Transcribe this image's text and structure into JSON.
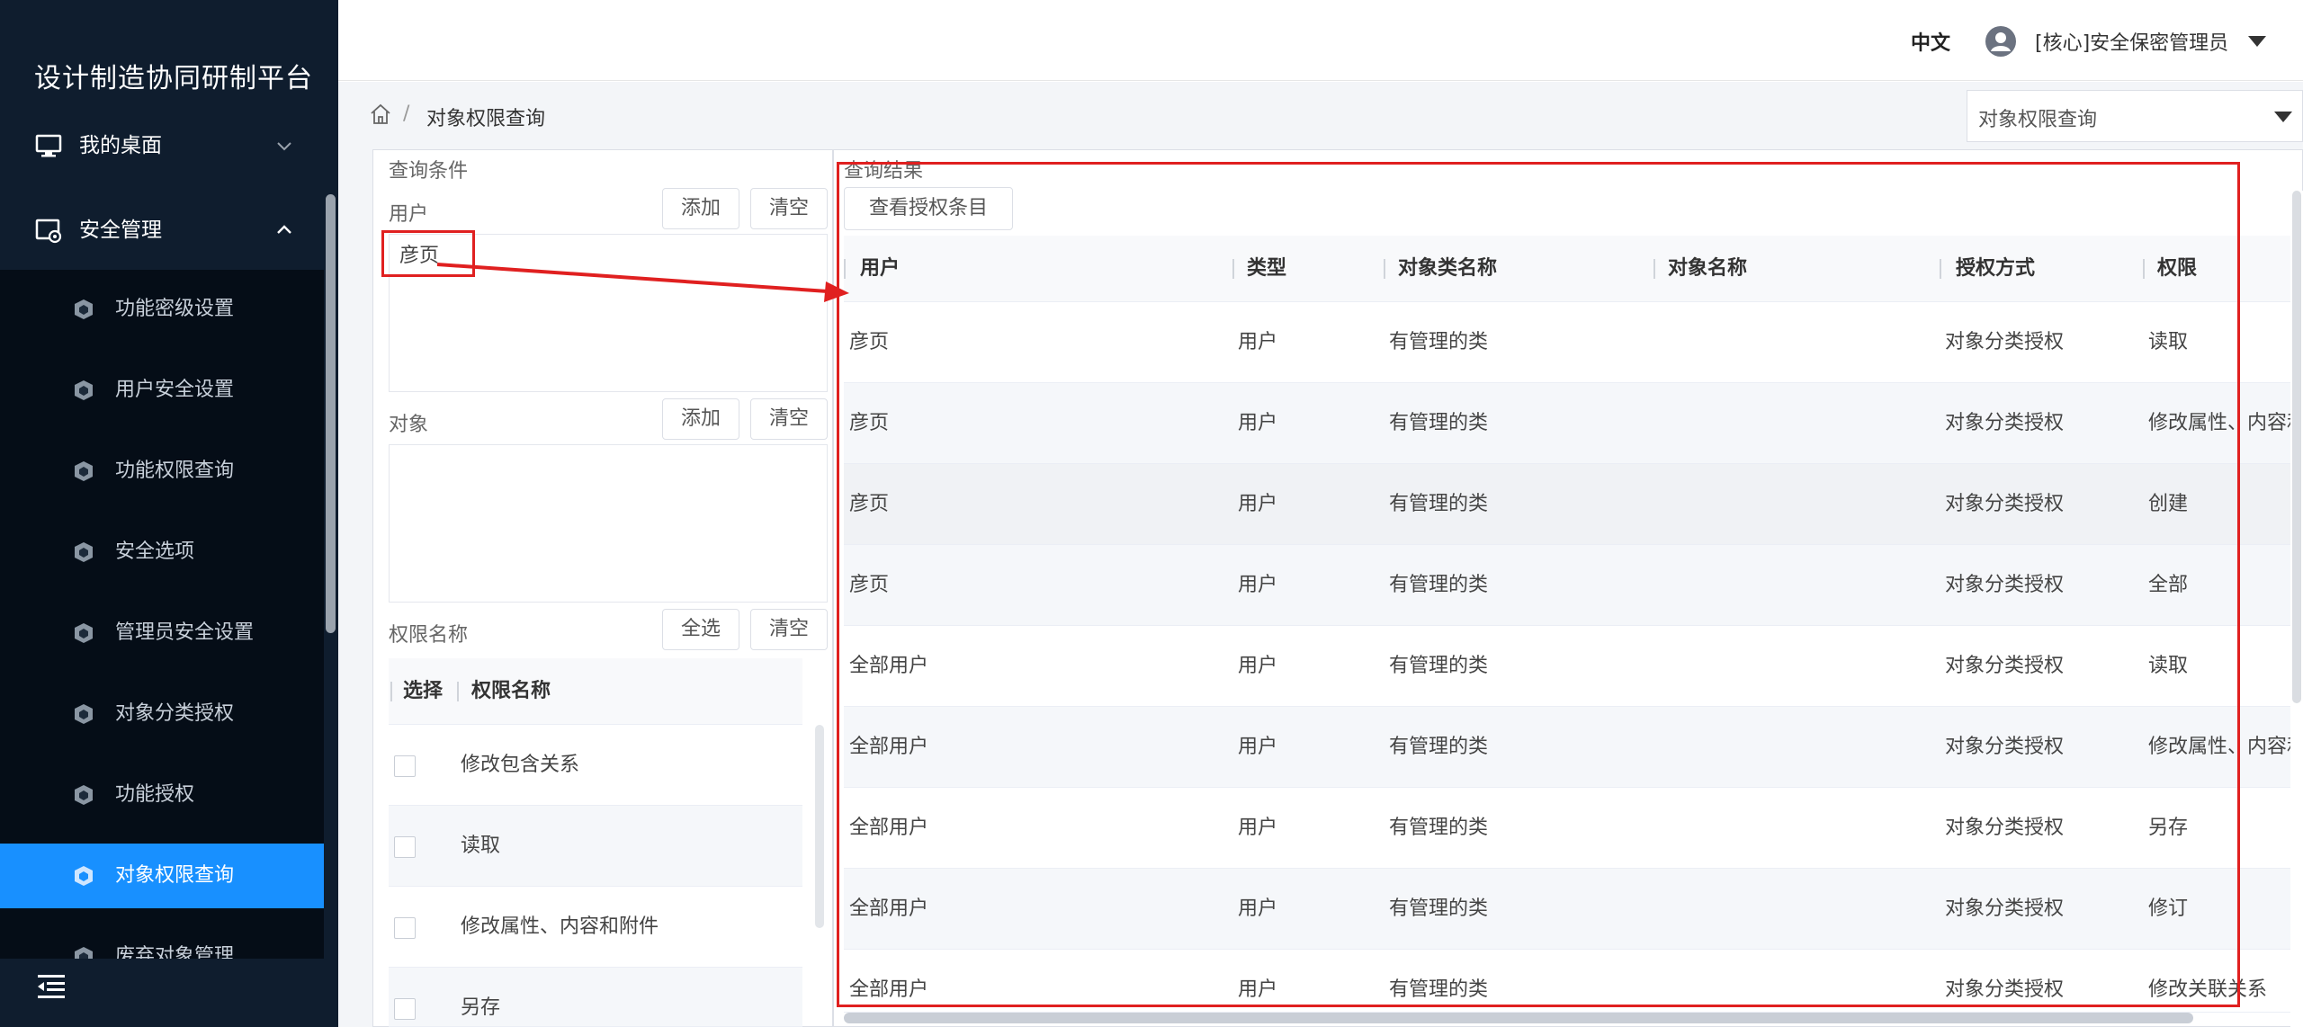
{
  "app": {
    "title": "设计制造协同研制平台"
  },
  "header": {
    "language": "中文",
    "user_name": "[核心]安全保密管理员"
  },
  "sidebar": {
    "top_items": [
      {
        "label": "我的桌面",
        "icon": "monitor-icon",
        "expanded": false
      },
      {
        "label": "安全管理",
        "icon": "security-settings-icon",
        "expanded": true
      }
    ],
    "sub_items": [
      {
        "label": "功能密级设置"
      },
      {
        "label": "用户安全设置"
      },
      {
        "label": "功能权限查询"
      },
      {
        "label": "安全选项"
      },
      {
        "label": "管理员安全设置"
      },
      {
        "label": "对象分类授权"
      },
      {
        "label": "功能授权"
      },
      {
        "label": "对象权限查询",
        "active": true
      },
      {
        "label": "废弃对象管理"
      }
    ]
  },
  "breadcrumb": {
    "separator": "/",
    "current": "对象权限查询"
  },
  "page_select": {
    "value": "对象权限查询"
  },
  "query": {
    "title": "查询条件",
    "user_section": {
      "label": "用户",
      "add": "添加",
      "clear": "清空",
      "selected": "彦页"
    },
    "object_section": {
      "label": "对象",
      "add": "添加",
      "clear": "清空"
    },
    "permission_section": {
      "label": "权限名称",
      "select_all": "全选",
      "clear": "清空",
      "columns": [
        "选择",
        "权限名称"
      ],
      "items": [
        "修改包含关系",
        "读取",
        "修改属性、内容和附件",
        "另存"
      ]
    }
  },
  "results": {
    "title": "查询结果",
    "view_button": "查看授权条目",
    "columns": [
      "用户",
      "类型",
      "对象类名称",
      "对象名称",
      "授权方式",
      "权限"
    ],
    "rows": [
      [
        "彦页",
        "用户",
        "有管理的类",
        "",
        "对象分类授权",
        "读取"
      ],
      [
        "彦页",
        "用户",
        "有管理的类",
        "",
        "对象分类授权",
        "修改属性、内容和附件"
      ],
      [
        "彦页",
        "用户",
        "有管理的类",
        "",
        "对象分类授权",
        "创建"
      ],
      [
        "彦页",
        "用户",
        "有管理的类",
        "",
        "对象分类授权",
        "全部"
      ],
      [
        "全部用户",
        "用户",
        "有管理的类",
        "",
        "对象分类授权",
        "读取"
      ],
      [
        "全部用户",
        "用户",
        "有管理的类",
        "",
        "对象分类授权",
        "修改属性、内容和附件"
      ],
      [
        "全部用户",
        "用户",
        "有管理的类",
        "",
        "对象分类授权",
        "另存"
      ],
      [
        "全部用户",
        "用户",
        "有管理的类",
        "",
        "对象分类授权",
        "修订"
      ],
      [
        "全部用户",
        "用户",
        "有管理的类",
        "",
        "对象分类授权",
        "修改关联关系"
      ]
    ]
  },
  "colors": {
    "sidebar": "#0f1d2e",
    "submenu": "#050d17",
    "accent": "#1890ff",
    "annotation": "#e02020"
  }
}
